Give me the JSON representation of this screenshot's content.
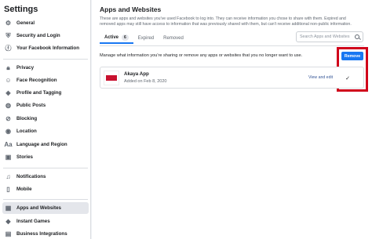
{
  "sidebar": {
    "title": "Settings",
    "items": [
      {
        "label": "General",
        "icon": "gear-icon"
      },
      {
        "label": "Security and Login",
        "icon": "shield-icon"
      },
      {
        "label": "Your Facebook Information",
        "icon": "facebook-icon"
      },
      {
        "label": "Privacy",
        "icon": "lock-icon"
      },
      {
        "label": "Face Recognition",
        "icon": "face-icon"
      },
      {
        "label": "Profile and Tagging",
        "icon": "tag-icon"
      },
      {
        "label": "Public Posts",
        "icon": "globe-icon"
      },
      {
        "label": "Blocking",
        "icon": "block-icon"
      },
      {
        "label": "Location",
        "icon": "location-icon"
      },
      {
        "label": "Language and Region",
        "icon": "language-icon"
      },
      {
        "label": "Stories",
        "icon": "stories-icon"
      },
      {
        "label": "Notifications",
        "icon": "bell-icon"
      },
      {
        "label": "Mobile",
        "icon": "mobile-icon"
      },
      {
        "label": "Apps and Websites",
        "icon": "apps-icon"
      },
      {
        "label": "Instant Games",
        "icon": "games-icon"
      },
      {
        "label": "Business Integrations",
        "icon": "business-icon"
      }
    ]
  },
  "main": {
    "title": "Apps and Websites",
    "description": "These are apps and websites you've used Facebook to log into. They can receive information you chose to share with them. Expired and removed apps may still have access to information that was previously shared with them, but can't receive additional non-public information.",
    "tabs": [
      {
        "label": "Active",
        "count": "6"
      },
      {
        "label": "Expired"
      },
      {
        "label": "Removed"
      }
    ],
    "search_placeholder": "Search Apps and Websites",
    "manage_text": "Manage what information you're sharing or remove any apps or websites that you no longer want to use.",
    "remove_label": "Remove",
    "app": {
      "name": "Akaya App",
      "date": "Added on Feb 8, 2020",
      "view_edit": "View and edit",
      "check": "✓"
    }
  },
  "colors": {
    "accent": "#1877f2",
    "highlight": "#d0021b",
    "app_logo": "#c8102e"
  }
}
